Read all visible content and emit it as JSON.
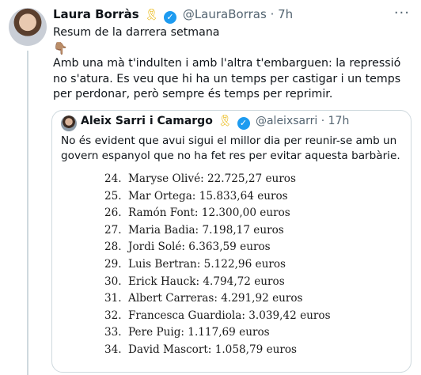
{
  "tweet": {
    "author_name": "Laura Borràs",
    "ribbon": "🎗",
    "handle": "@LauraBorras",
    "separator": "·",
    "time": "7h",
    "more_icon": "···",
    "line1": "Resum de la darrera setmana",
    "emoji": "👇🏽",
    "paragraph": "Amb una mà t'indulten i amb l'altra t'embarguen: la repressió no s'atura. Es veu que hi ha un temps per castigar i un temps per perdonar, però sempre és temps per reprimir."
  },
  "quote": {
    "author_name": "Aleix Sarri i Camargo",
    "ribbon": "🎗",
    "handle": "@aleixsarri",
    "separator": "·",
    "time": "17h",
    "text": "No és evident que avui sigui el millor dia per reunir-se amb un govern espanyol que no ha fet res per evitar aquesta barbàrie.",
    "list": [
      {
        "num": "24.",
        "text": "Maryse Olivé: 22.725,27 euros"
      },
      {
        "num": "25.",
        "text": "Mar Ortega: 15.833,64 euros"
      },
      {
        "num": "26.",
        "text": "Ramón Font: 12.300,00 euros"
      },
      {
        "num": "27.",
        "text": "Maria Badia: 7.198,17 euros"
      },
      {
        "num": "28.",
        "text": "Jordi Solé: 6.363,59 euros"
      },
      {
        "num": "29.",
        "text": "Luis Bertran: 5.122,96 euros"
      },
      {
        "num": "30.",
        "text": "Erick Hauck: 4.794,72 euros"
      },
      {
        "num": "31.",
        "text": "Albert Carreras: 4.291,92 euros"
      },
      {
        "num": "32.",
        "text": "Francesca Guardiola: 3.039,42 euros"
      },
      {
        "num": "33.",
        "text": "Pere Puig: 1.117,69 euros"
      },
      {
        "num": "34.",
        "text": "David Mascort: 1.058,79 euros"
      }
    ]
  },
  "colors": {
    "accent": "#1d9bf0",
    "secondary_text": "#536471",
    "border": "#cfd9de"
  }
}
